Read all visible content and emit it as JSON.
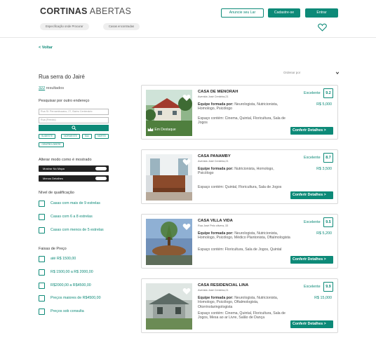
{
  "header": {
    "brand_bold": "CORTINAS",
    "brand_light": "ABERTAS",
    "pill_1": "Especificação onde Procurar",
    "pill_2": "Casas encontradas",
    "btn_advertise": "Anuncie seu Lar",
    "btn_signup": "Cadastre-se",
    "btn_login": "Entrar"
  },
  "back_label": "< Voltar",
  "sort": {
    "label": "Ordenar por"
  },
  "sidebar": {
    "search_title": "Rua serra do Jairé",
    "results_count": "322",
    "results_suffix": "resultados",
    "other_address_label": "Pesquisar por outro endereço",
    "address_value": "Rua St. Pernambucano, 27, Bairro Centenário",
    "address_placeholder": "Rua (Ferroto)",
    "region_chips": [
      "SUDESTE",
      "NORDESTE",
      "SUL",
      "NORTE",
      "CENTRO-OESTE"
    ],
    "mode_label": "Alterar modo como é mostrado",
    "mode_options": [
      "Mostrar No Mapa",
      "Menos Detalhes"
    ],
    "qualification_label": "Nível de qualificação",
    "qualification_options": [
      "Casas com mais de 9 estrelas",
      "Casas com 6 a 8 estrelas",
      "Casas com menos de 5 estrelas"
    ],
    "price_label": "Faixas de Preço",
    "price_options": [
      "até R$ 1500,00",
      "R$ 1500,00 a R$ 2000,00",
      "R$2000,00 a R$4500,00",
      "Preços maiores de R$4500,00",
      "Preços sob consulta"
    ]
  },
  "listings": [
    {
      "title": "CASA DE MENORAH",
      "address": "Avenida José Cerdeira,21",
      "team_label": "Equipe formada por:",
      "team": "Neurologista, Nutricionista, Homologo, Psicólogo",
      "space_label": "Espaço contém:",
      "space": "Cinema, Quintal, Floricultura, Sala de Jogos",
      "rating_label": "Excelente",
      "rating": "9.2",
      "price": "R$ 5,000",
      "badge": "Em Destaque",
      "cta": "Conferir Detalhes >"
    },
    {
      "title": "CASA PANAMBY",
      "address": "Avenida José Cerdeira,21",
      "team_label": "Equipe formada por:",
      "team": "Nutricionista, Homologo, Psicólogo",
      "space_label": "Espaço contém:",
      "space": "Quintal, Floricultura, Sala de Jogos",
      "rating_label": "Excelente",
      "rating": "8.7",
      "price": "R$ 3,500",
      "badge": "",
      "cta": "Conferir Detalhes >"
    },
    {
      "title": "CASA VILLA VIDA",
      "address": "Rua José Pelo olivera, 33",
      "team_label": "Equipe formada por:",
      "team": "Neurologista, Nutricionista, Homologo, Psicólogo, Médico Plantonista, Oftalmologista",
      "space_label": "Espaço contém:",
      "space": "Floricultura, Sala de Jogos, Quintal",
      "rating_label": "Excelente",
      "rating": "9.5",
      "price": "R$ 5,200",
      "badge": "",
      "cta": "Conferir Detalhes >"
    },
    {
      "title": "CASA RESIDENCIAL LINA",
      "address": "Avenida José Cerdeira,21",
      "team_label": "Equipe formada por:",
      "team": "Neurologista, Nutricionista, Homologo, Psicólogo, Oftalmologista, Otorrinolaringologista",
      "space_label": "Espaço contém:",
      "space": "Cinema, Quintal, Floricultura, Sala de Jogos, Mesa ao ar Livre, Salão de Dança",
      "rating_label": "Excelente",
      "rating": "9.9",
      "price": "R$ 15,000",
      "badge": "",
      "cta": "Conferir Detalhes >"
    }
  ],
  "colors": {
    "accent": "#0d8a78",
    "dark": "#222222"
  }
}
